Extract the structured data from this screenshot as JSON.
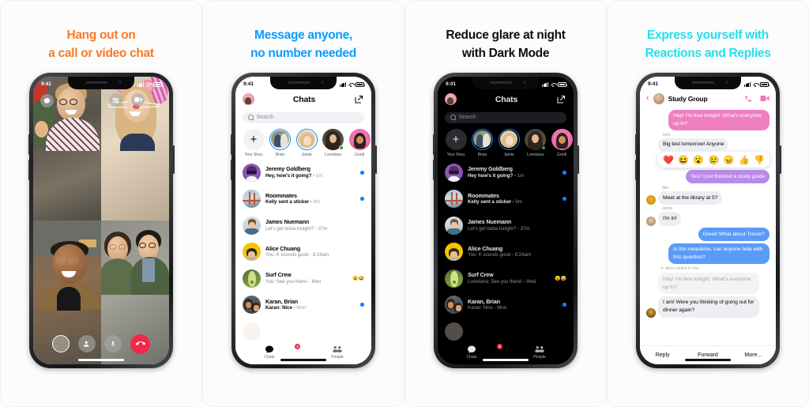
{
  "panels": [
    {
      "id": "video-call",
      "headline_line1": "Hang out on",
      "headline_line2": "a call or video chat",
      "headline_color": "#f97b22",
      "status_time": "9:41",
      "controls": {
        "chat_bubble": "chat-icon",
        "effects": "camera-effects-icon",
        "flip_camera": "video-flip-icon",
        "shutter": "shutter-button",
        "add_person": "add-person-icon",
        "mute": "microphone-icon",
        "end_call": "end-call-icon"
      }
    },
    {
      "id": "chats-light",
      "headline_line1": "Message anyone,",
      "headline_line2": "no number needed",
      "headline_color": "#0a9bff",
      "status_time": "9:41",
      "header_title": "Chats",
      "search_placeholder": "Search",
      "stories": [
        {
          "label": "Your Story",
          "type": "add"
        },
        {
          "label": "Brian",
          "type": "active"
        },
        {
          "label": "Jamie",
          "type": "active"
        },
        {
          "label": "Loredana",
          "type": "plain",
          "online": true
        },
        {
          "label": "Gordi",
          "type": "plain"
        }
      ],
      "chats": [
        {
          "name": "Jeremy Goldberg",
          "preview": "Hey, how's it going?",
          "time": "1m",
          "unread": true
        },
        {
          "name": "Roommates",
          "preview": "Kelly sent a sticker",
          "time": "9m",
          "unread": true
        },
        {
          "name": "James Nuemann",
          "preview": "Let's get boba tonight?",
          "time": "37m",
          "unread": false
        },
        {
          "name": "Alice Chuang",
          "preview": "You: K sounds good",
          "time": "8:24am",
          "unread": false
        },
        {
          "name": "Surf Crew",
          "preview": "You: See you there!",
          "time": "Mon",
          "unread": false,
          "reactions": "😮😂"
        },
        {
          "name": "Karan, Brian",
          "preview": "Karan: Nice",
          "time": "Mon",
          "unread": true
        }
      ],
      "tabs": [
        {
          "label": "Chats",
          "icon": "chat-bubble-icon",
          "badge": "3"
        },
        {
          "label": "People",
          "icon": "people-icon",
          "badge": ""
        }
      ]
    },
    {
      "id": "chats-dark",
      "headline_line1": "Reduce glare at night",
      "headline_line2": "with Dark Mode",
      "headline_color": "#0d0d0d",
      "status_time": "9:41",
      "header_title": "Chats",
      "search_placeholder": "Search",
      "stories": [
        {
          "label": "Your Story",
          "type": "add"
        },
        {
          "label": "Brian",
          "type": "active"
        },
        {
          "label": "Jamie",
          "type": "active"
        },
        {
          "label": "Loredana",
          "type": "plain",
          "online": true
        },
        {
          "label": "Gordi",
          "type": "plain"
        }
      ],
      "chats": [
        {
          "name": "Jeremy Goldberg",
          "preview": "Hey how's it going?",
          "time": "1m",
          "unread": true
        },
        {
          "name": "Roommates",
          "preview": "Kelly sent a sticker",
          "time": "9m",
          "unread": true
        },
        {
          "name": "James Nuemann",
          "preview": "Let's get boba tonight?",
          "time": "37m",
          "unread": false
        },
        {
          "name": "Alice Chuang",
          "preview": "You: K sounds good",
          "time": "8:24am",
          "unread": false
        },
        {
          "name": "Surf Crew",
          "preview": "Loredana: See you there!",
          "time": "Wed",
          "unread": false,
          "reactions": "😮😂"
        },
        {
          "name": "Karan, Brian",
          "preview": "Karan: Nice",
          "time": "Mon",
          "unread": true
        }
      ],
      "tabs": [
        {
          "label": "Chats",
          "icon": "chat-bubble-icon",
          "badge": "3"
        },
        {
          "label": "People",
          "icon": "people-icon",
          "badge": ""
        }
      ]
    },
    {
      "id": "reactions",
      "headline_line1": "Express yourself with",
      "headline_line2": "Reactions and Replies",
      "headline_color": "#21e0ef",
      "status_time": "9:41",
      "thread_title": "Study Group",
      "messages": [
        {
          "kind": "out",
          "color": "pink",
          "text": "Hey! I'm free tonight. What's everyone up to?"
        },
        {
          "kind": "sender",
          "text": "Josh"
        },
        {
          "kind": "in",
          "color": "grey",
          "text": "Big test tomorrow! Anyone"
        },
        {
          "kind": "reactions",
          "emojis": [
            "❤️",
            "😆",
            "😮",
            "😢",
            "😠",
            "👍",
            "👎"
          ]
        },
        {
          "kind": "out",
          "color": "purple",
          "text": "Yes! I just finished a study guide"
        },
        {
          "kind": "sender",
          "text": "Mai"
        },
        {
          "kind": "in",
          "color": "grey",
          "text": "Meet at the library at 5?"
        },
        {
          "kind": "sender",
          "text": "Jamie"
        },
        {
          "kind": "in",
          "color": "grey",
          "text": "I'm in!"
        },
        {
          "kind": "out",
          "color": "blue",
          "text": "Great! What about Trevor?"
        },
        {
          "kind": "out",
          "color": "blue",
          "text": "In the meantime, can anyone help with this question?"
        },
        {
          "kind": "replied",
          "text": "Alice replied to You"
        },
        {
          "kind": "in",
          "color": "quote",
          "text": "Hey! I'm free tonight. What's everyone up to?"
        },
        {
          "kind": "in",
          "color": "grey",
          "text": "I am! Were you thinking of going out for dinner again?"
        }
      ],
      "actions": [
        {
          "label": "Reply"
        },
        {
          "label": "Forward"
        },
        {
          "label": "More..."
        }
      ]
    }
  ]
}
